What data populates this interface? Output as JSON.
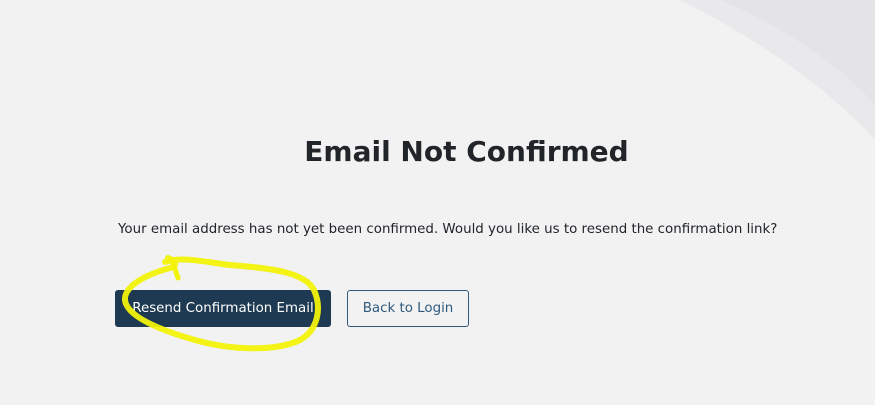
{
  "page": {
    "title": "Email Not Confirmed",
    "message": "Your email address has not yet been confirmed. Would you like us to resend the confirmation link?"
  },
  "actions": {
    "resend_label": "Resend Confirmation Email",
    "back_label": "Back to Login"
  },
  "colors": {
    "primary_button": "#1e3a52",
    "outline_button": "#2f5a7d",
    "highlight": "#f2f20a",
    "background": "#f2f2f3"
  },
  "annotations": {
    "highlight_shape": "yellow-scribble-circle"
  }
}
